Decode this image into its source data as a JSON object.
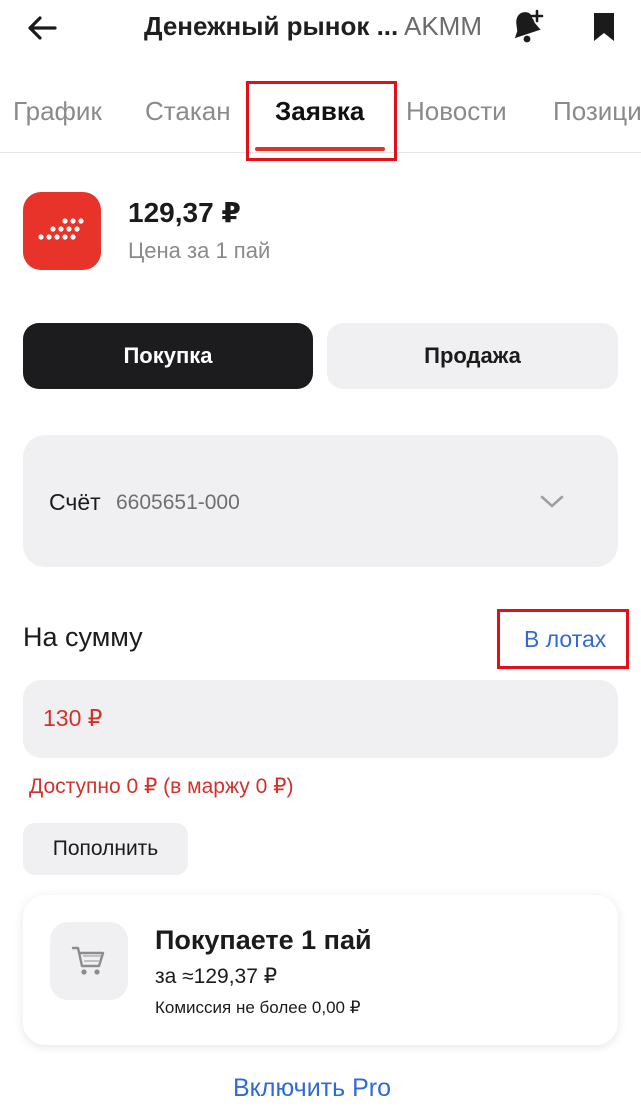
{
  "header": {
    "title": "Денежный рынок ...",
    "ticker": "AKMM"
  },
  "tabs": [
    {
      "label": "График"
    },
    {
      "label": "Стакан"
    },
    {
      "label": "Заявка"
    },
    {
      "label": "Новости"
    },
    {
      "label": "Позици"
    }
  ],
  "active_tab": "Заявка",
  "instrument": {
    "price": "129,37 ₽",
    "price_label": "Цена за 1 пай"
  },
  "side": {
    "buy_label": "Покупка",
    "sell_label": "Продажа",
    "selected": "Покупка"
  },
  "account": {
    "label": "Счёт",
    "number": "6605651-000"
  },
  "amount": {
    "label": "На сумму",
    "lots_link": "В лотах",
    "value": "130 ₽",
    "available": "Доступно 0 ₽ (в маржу 0 ₽)",
    "topup_label": "Пополнить"
  },
  "summary": {
    "title": "Покупаете 1 пай",
    "price": "за ≈129,37 ₽",
    "fee": "Комиссия не более 0,00 ₽"
  },
  "pro_link": "Включить Pro",
  "colors": {
    "accent_red": "#e8332a",
    "link_blue": "#2f6ad8",
    "error_red": "#d3322b",
    "dark_button": "#1c1c1e",
    "field_bg": "#f0f0f2"
  },
  "icons": [
    "back-arrow-icon",
    "bell-plus-icon",
    "bookmark-icon",
    "fund-logo-icon",
    "chevron-down-icon",
    "cart-icon"
  ]
}
